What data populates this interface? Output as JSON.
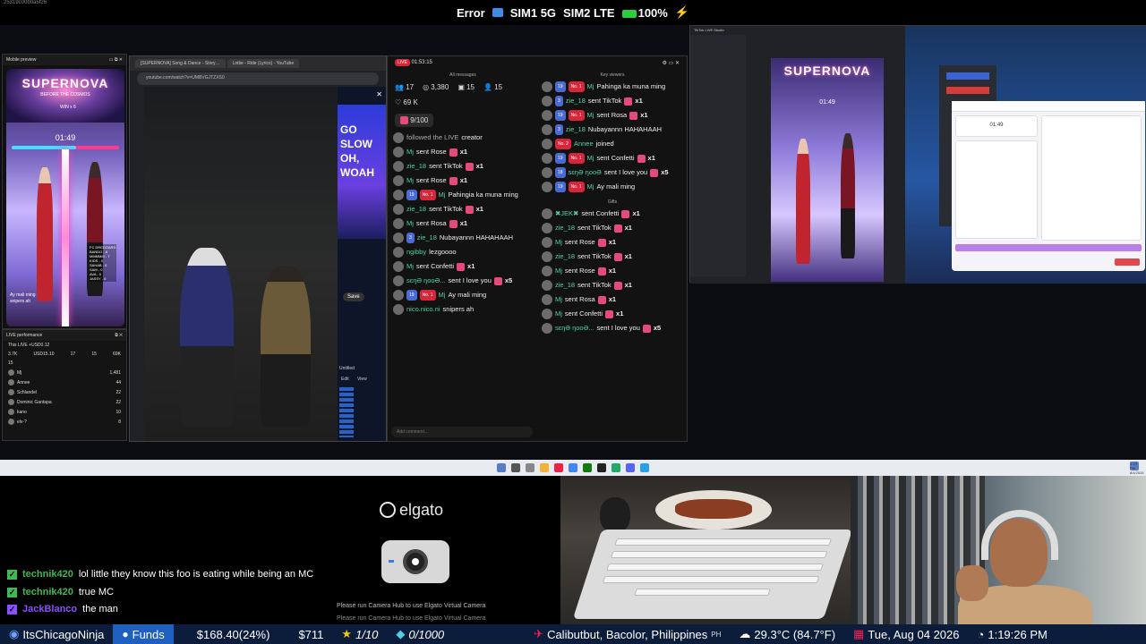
{
  "statusbar": {
    "tiny": "25319c00b0a5f26",
    "error": "Error",
    "sim1": "SIM1 5G",
    "sim2": "SIM2 LTE",
    "battery": "100%",
    "bolt": "⚡"
  },
  "mobile_preview": {
    "title": "Mobile preview",
    "banner": "SUPERNOVA",
    "sub": "BEFORE THE COSMOS",
    "win": "WIN x 6",
    "timer": "01:49",
    "chat": [
      "Ay mali ming",
      "snipers ah"
    ],
    "score_list": [
      "FC DREDOARD",
      "BANDO - 8",
      "MMMMM - 7",
      "KIDS - 0",
      "SAHAB - 0",
      "SAM - 0",
      "AVA - 0",
      "JASSY - 0"
    ]
  },
  "live_performance": {
    "title": "LIVE performance",
    "subtitle": "This LIVE +USD0.12",
    "stats": [
      "3.7K",
      "USD15.10",
      "17",
      "15",
      "69K"
    ],
    "count": "15",
    "rows": [
      {
        "name": "Mj",
        "value": "1,481"
      },
      {
        "name": "Annee",
        "value": "44"
      },
      {
        "name": "Schlandel",
        "value": "22"
      },
      {
        "name": "Dominic Gantapa",
        "value": "22"
      },
      {
        "name": "kano",
        "value": "10"
      },
      {
        "name": "elv-?",
        "value": "8"
      }
    ]
  },
  "browser": {
    "tabs": [
      "[SUPERNOVA] Song & Dance - Story…",
      "Lottie - Ride (Lyrics) - YouTube"
    ],
    "url": "youtube.com/watch?v=UMBVGJTZXS0",
    "neon": [
      "GO SLOW",
      "OH, WOAH"
    ],
    "save": "Save",
    "edit": "Edit",
    "view": "View",
    "untitled": "Untitled"
  },
  "chat_window": {
    "time": "01:53:15",
    "all_messages_label": "All messages",
    "key_viewers_label": "Key viewers",
    "gifts_label": "Gifts",
    "stats": {
      "users": "17",
      "views": "3,380",
      "calendar": "15",
      "people": "15",
      "likes": "69 K"
    },
    "goal": "9/100",
    "left_messages": [
      {
        "user": "",
        "text": "creator",
        "pre": "followed the LIVE"
      },
      {
        "user": "Mj",
        "text": "sent Rose",
        "count": "x1"
      },
      {
        "user": "zie_18",
        "text": "sent TikTok",
        "count": "x1"
      },
      {
        "user": "Mj",
        "text": "sent Rose",
        "count": "x1"
      },
      {
        "user": "Mj",
        "badge": "No. 1",
        "level": "19",
        "text": "Pahingia ka muna ming"
      },
      {
        "user": "zie_18",
        "text": "sent TikTok",
        "count": "x1"
      },
      {
        "user": "Mj",
        "text": "sent Rosa",
        "count": "x1"
      },
      {
        "user": "zie_18",
        "level": "3",
        "text": "Nubayannn HAHAHAAH"
      },
      {
        "user": "ngibby",
        "text": "lezgoooo"
      },
      {
        "user": "Mj",
        "text": "sent Confetti",
        "count": "x1"
      },
      {
        "user": "sɛŋƏ ŋooƏ...",
        "text": "sent I love you",
        "count": "x5"
      },
      {
        "user": "Mj",
        "badge": "No. 1",
        "level": "19",
        "text": "Ay mali ming"
      },
      {
        "user": "nico.nico.ni",
        "text": "snipers ah"
      }
    ],
    "right_messages": [
      {
        "user": "Mj",
        "badge": "No. 1",
        "level": "19",
        "text": "Pahinga ka muna ming"
      },
      {
        "user": "zie_18",
        "level": "3",
        "text": "sent TikTok",
        "count": "x1"
      },
      {
        "user": "Mj",
        "badge": "No. 1",
        "level": "19",
        "text": "sent Rosa",
        "count": "x1"
      },
      {
        "user": "zie_18",
        "level": "3",
        "text": "Nubayannn HAHAHAAH"
      },
      {
        "user": "Annee",
        "badge": "No. 2",
        "text": "joined"
      },
      {
        "user": "Mj",
        "badge": "No. 1",
        "level": "19",
        "text": "sent Confetti",
        "count": "x1"
      },
      {
        "user": "sɛŋƏ ŋooƏ",
        "level": "18",
        "text": "sent I love you",
        "count": "x5"
      },
      {
        "user": "Mj",
        "badge": "No. 1",
        "level": "19",
        "text": "Ay mali ming"
      }
    ],
    "gift_messages": [
      {
        "user": "✖JEK✖",
        "text": "sent Confetti",
        "count": "x1"
      },
      {
        "user": "zie_18",
        "text": "sent TikTok",
        "count": "x1"
      },
      {
        "user": "Mj",
        "text": "sent Rose",
        "count": "x1"
      },
      {
        "user": "zie_18",
        "text": "sent TikTok",
        "count": "x1"
      },
      {
        "user": "Mj",
        "text": "sent Rose",
        "count": "x1"
      },
      {
        "user": "zie_18",
        "text": "sent TikTok",
        "count": "x1"
      },
      {
        "user": "Mj",
        "text": "sent Rosa",
        "count": "x1"
      },
      {
        "user": "Mj",
        "text": "sent Confetti",
        "count": "x1"
      },
      {
        "user": "sɛŋƏ ŋooƏ...",
        "text": "sent I love you",
        "count": "x5"
      }
    ],
    "input_placeholder": "Add comment..."
  },
  "studio": {
    "title": "TikTok LIVE Studio",
    "banner": "SUPERNOVA",
    "timer": "01:49"
  },
  "panel2": {
    "timer": "01:49"
  },
  "elgato": {
    "brand": "elgato",
    "note": "Please run Camera Hub to use Elgato Virtual Camera",
    "note2": "Please run Camera Hub to use Elgato Virtual Camera"
  },
  "twitch_chat": [
    {
      "user": "technik420",
      "text": "lol little they know this foo is eating while being an MC",
      "color": "#3fb950"
    },
    {
      "user": "technik420",
      "text": "true MC",
      "color": "#3fb950"
    },
    {
      "user": "JackBlanco",
      "text": "the man",
      "color": "#8a4fff"
    }
  ],
  "ticker": {
    "channel": "ItsChicagoNinja",
    "funds_label": "Funds",
    "funds_value": "$168.40(24%)",
    "amount": "$711",
    "star": "1/10",
    "gem": "0/1000",
    "location": "Calibutbut, Bacolor, Philippines",
    "country": "PH",
    "weather": "29.3°C (84.7°F)",
    "date": "Tue, Aug 04 2026",
    "time": "1:19:26 PM"
  },
  "taskbar": {
    "clock": "1:19 PM",
    "date": "8/4/2026"
  }
}
